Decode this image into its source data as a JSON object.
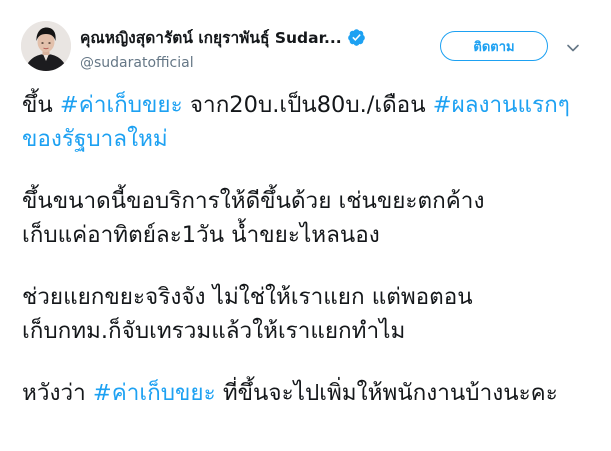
{
  "author": {
    "display_name": "คุณหญิงสุดารัตน์ เกยุราพันธุ์ Sudar...",
    "handle": "@sudaratofficial",
    "verified": true
  },
  "follow_button": {
    "label": "ติดตาม"
  },
  "icons": {
    "verified": "verified-badge-icon",
    "menu": "chevron-down-icon"
  },
  "colors": {
    "accent": "#1da1f2",
    "text": "#14171a",
    "secondary": "#657786"
  },
  "tweet": {
    "p1": {
      "t1": "ขึ้น ",
      "h1": "#ค่าเก็บขยะ",
      "t2": " จาก20บ.เป็น80บ./เดือน ",
      "h2": "#ผลงานแรกๆของรัฐบาลใหม่"
    },
    "p2": {
      "line1": "ขึ้นขนาดนี้ขอบริการให้ดีขึ้นด้วย เช่นขยะตกค้าง",
      "line2": "เก็บแค่อาทิตย์ละ1วัน น้ำขยะไหลนอง"
    },
    "p3": {
      "line1": "ช่วยแยกขยะจริงจัง ไม่ใช่ให้เราแยก แต่พอตอน",
      "line2": "เก็บกทม.ก็จับเทรวมแล้วให้เราแยกทำไม"
    },
    "p4": {
      "t1": "หวังว่า ",
      "h1": "#ค่าเก็บขยะ",
      "t2": " ที่ขึ้นจะไปเพิ่มให้พนักงานบ้างนะคะ"
    }
  }
}
